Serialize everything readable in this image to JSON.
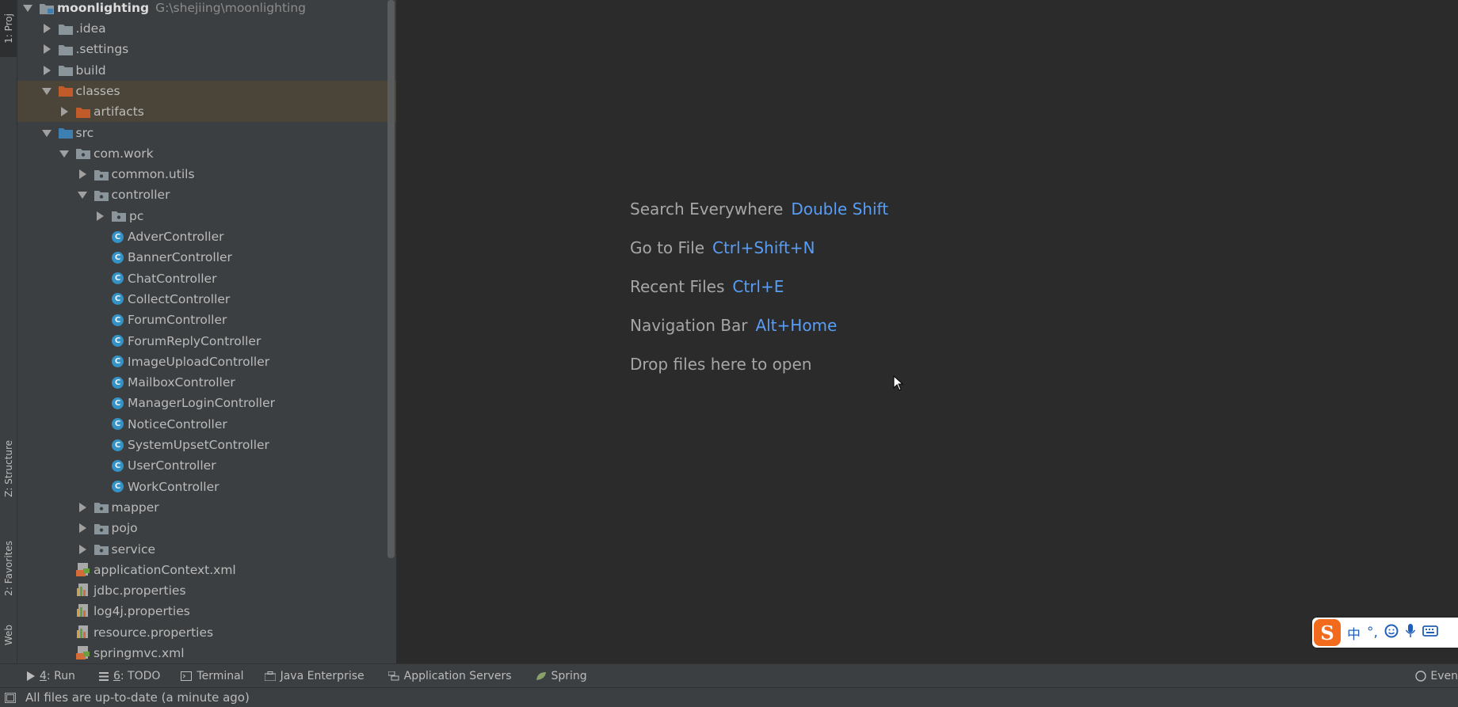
{
  "left_stripe": {
    "project_tab": "1: Proj",
    "structure_tab": "Z: Structure",
    "favorites_tab": "2: Favorites",
    "web_tab": "Web"
  },
  "project_tree": {
    "root": {
      "label": "moonlighting",
      "path": "G:\\shejiing\\moonlighting"
    },
    "rows": [
      {
        "label": ".idea",
        "kind": "folder",
        "arrow": "right",
        "depth": 1
      },
      {
        "label": ".settings",
        "kind": "folder",
        "arrow": "right",
        "depth": 1
      },
      {
        "label": "build",
        "kind": "folder",
        "arrow": "right",
        "depth": 1
      },
      {
        "label": "classes",
        "kind": "folder-excluded",
        "arrow": "down",
        "depth": 1
      },
      {
        "label": "artifacts",
        "kind": "folder-excluded",
        "arrow": "right",
        "depth": 2
      },
      {
        "label": "src",
        "kind": "folder-source",
        "arrow": "down",
        "depth": 1
      },
      {
        "label": "com.work",
        "kind": "package",
        "arrow": "down",
        "depth": 2
      },
      {
        "label": "common.utils",
        "kind": "package",
        "arrow": "right",
        "depth": 3
      },
      {
        "label": "controller",
        "kind": "package",
        "arrow": "down",
        "depth": 3
      },
      {
        "label": "pc",
        "kind": "package",
        "arrow": "right",
        "depth": 4
      },
      {
        "label": "AdverController",
        "kind": "class",
        "arrow": "none",
        "depth": 4
      },
      {
        "label": "BannerController",
        "kind": "class",
        "arrow": "none",
        "depth": 4
      },
      {
        "label": "ChatController",
        "kind": "class",
        "arrow": "none",
        "depth": 4
      },
      {
        "label": "CollectController",
        "kind": "class",
        "arrow": "none",
        "depth": 4
      },
      {
        "label": "ForumController",
        "kind": "class",
        "arrow": "none",
        "depth": 4
      },
      {
        "label": "ForumReplyController",
        "kind": "class",
        "arrow": "none",
        "depth": 4
      },
      {
        "label": "ImageUploadController",
        "kind": "class",
        "arrow": "none",
        "depth": 4
      },
      {
        "label": "MailboxController",
        "kind": "class",
        "arrow": "none",
        "depth": 4
      },
      {
        "label": "ManagerLoginController",
        "kind": "class",
        "arrow": "none",
        "depth": 4
      },
      {
        "label": "NoticeController",
        "kind": "class",
        "arrow": "none",
        "depth": 4
      },
      {
        "label": "SystemUpsetController",
        "kind": "class",
        "arrow": "none",
        "depth": 4
      },
      {
        "label": "UserController",
        "kind": "class",
        "arrow": "none",
        "depth": 4
      },
      {
        "label": "WorkController",
        "kind": "class",
        "arrow": "none",
        "depth": 4
      },
      {
        "label": "mapper",
        "kind": "package",
        "arrow": "right",
        "depth": 3
      },
      {
        "label": "pojo",
        "kind": "package",
        "arrow": "right",
        "depth": 3
      },
      {
        "label": "service",
        "kind": "package",
        "arrow": "right",
        "depth": 3
      },
      {
        "label": "applicationContext.xml",
        "kind": "xml",
        "arrow": "none",
        "depth": 2
      },
      {
        "label": "jdbc.properties",
        "kind": "properties",
        "arrow": "none",
        "depth": 2
      },
      {
        "label": "log4j.properties",
        "kind": "properties",
        "arrow": "none",
        "depth": 2
      },
      {
        "label": "resource.properties",
        "kind": "properties",
        "arrow": "none",
        "depth": 2
      },
      {
        "label": "springmvc.xml",
        "kind": "xml",
        "arrow": "none",
        "depth": 2
      }
    ]
  },
  "welcome": {
    "search_everywhere": {
      "label": "Search Everywhere",
      "shortcut": "Double Shift"
    },
    "go_to_file": {
      "label": "Go to File",
      "shortcut": "Ctrl+Shift+N"
    },
    "recent_files": {
      "label": "Recent Files",
      "shortcut": "Ctrl+E"
    },
    "navigation_bar": {
      "label": "Navigation Bar",
      "shortcut": "Alt+Home"
    },
    "drop_files": "Drop files here to open"
  },
  "ime_toolbar": {
    "logo": "S",
    "lang": "中",
    "punct": "°,",
    "icons": [
      "smile-icon",
      "microphone-icon",
      "keyboard-icon"
    ]
  },
  "bottom_tabs": {
    "run": {
      "mnemonic": "4",
      "label": ": Run"
    },
    "todo": {
      "mnemonic": "6",
      "label": ": TODO"
    },
    "terminal": "Terminal",
    "java_enterprise": "Java Enterprise",
    "application_servers": "Application Servers",
    "spring": "Spring",
    "event_log": "Even"
  },
  "status": {
    "message": "All files are up-to-date (a minute ago)"
  },
  "colors": {
    "panel_bg": "#3c3f41",
    "editor_bg": "#2b2b2b",
    "shortcut": "#589df6",
    "class_icon": "#3592c4",
    "folder": "#8a949b",
    "excluded_folder": "#c15c2a",
    "source_folder": "#3c7fb0",
    "selection": "#4a4538"
  }
}
